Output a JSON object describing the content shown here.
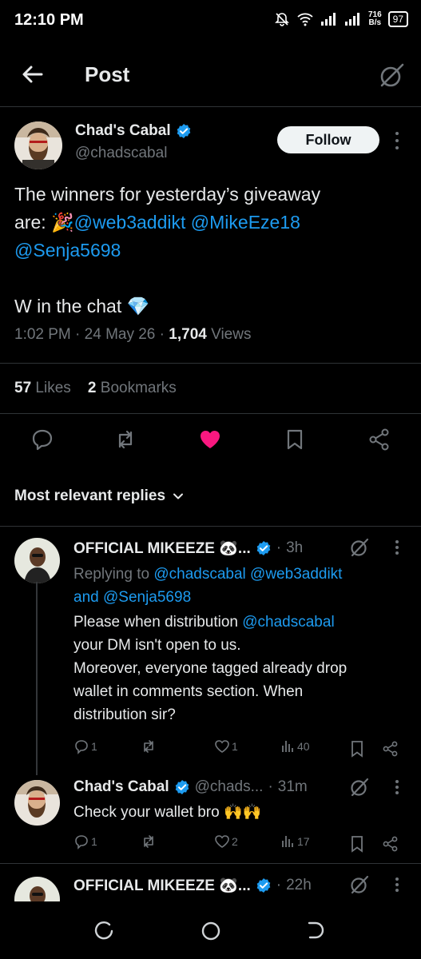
{
  "status": {
    "time": "12:10 PM",
    "net_speed_value": "716",
    "net_speed_unit": "B/s",
    "battery": "97"
  },
  "header": {
    "title": "Post"
  },
  "post": {
    "author_name": "Chad's Cabal",
    "author_handle": "@chadscabal",
    "follow_label": "Follow",
    "text_line1": "The winners for yesterday’s giveaway",
    "text_line2_prefix": "are: 🎉",
    "mention1": "@web3addikt",
    "mention2": "@MikeEze18",
    "mention3": "@Senja5698",
    "text_line4": "W in the chat 💎",
    "time": "1:02 PM",
    "date": "24 May 26",
    "views_count": "1,704",
    "views_label": "Views",
    "likes_count": "57",
    "likes_label": "Likes",
    "bookmarks_count": "2",
    "bookmarks_label": "Bookmarks",
    "liked": true
  },
  "sort": {
    "label": "Most relevant replies"
  },
  "replies": [
    {
      "name": "OFFICIAL MIKEEZE 🐼...",
      "time": "3h",
      "replying_prefix": "Replying to",
      "replying_to1": "@chadscabal",
      "replying_to2": "@web3addikt",
      "replying_and": "and",
      "replying_to3": "@Senja5698",
      "text_line1_prefix": "Please when distribution",
      "text_line1_mention": "@chadscabal",
      "text_line2": "your DM isn't open to us.",
      "text_line3": "Moreover, everyone tagged already drop",
      "text_line4": "wallet in comments section. When",
      "text_line5": "distribution sir?",
      "replies_count": "1",
      "likes_count": "1",
      "views_count": "40"
    },
    {
      "name": "Chad's Cabal",
      "handle": "@chads...",
      "time": "31m",
      "text": "Check your wallet bro 🙌🙌",
      "replies_count": "1",
      "likes_count": "2",
      "views_count": "17"
    },
    {
      "name": "OFFICIAL MIKEEZE 🐼...",
      "time": "22h"
    }
  ],
  "colors": {
    "accent": "#1d9bf0",
    "like": "#f91880",
    "muted": "#71767b"
  }
}
